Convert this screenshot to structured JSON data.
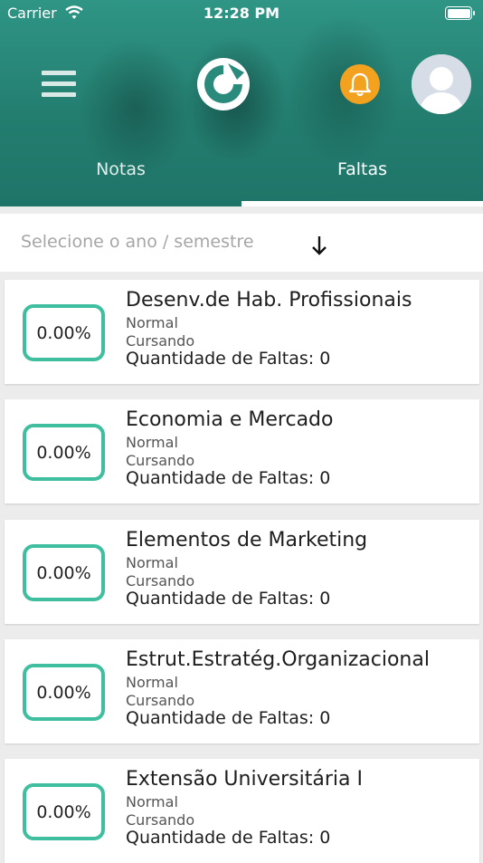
{
  "status_bar": {
    "carrier": "Carrier",
    "time": "12:28 PM"
  },
  "header": {
    "tabs": [
      {
        "label": "Notas",
        "active": false
      },
      {
        "label": "Faltas",
        "active": true
      }
    ]
  },
  "selector": {
    "placeholder": "Selecione o ano / semestre"
  },
  "colors": {
    "header_teal": "#237e70",
    "badge_border": "#3fbf9f",
    "bell": "#f3a21f"
  },
  "courses": [
    {
      "percent": "0.00%",
      "name": "Desenv.de Hab. Profissionais",
      "type": "Normal",
      "status": "Cursando",
      "faltas": "Quantidade de Faltas: 0"
    },
    {
      "percent": "0.00%",
      "name": "Economia e Mercado",
      "type": "Normal",
      "status": "Cursando",
      "faltas": "Quantidade de Faltas: 0"
    },
    {
      "percent": "0.00%",
      "name": "Elementos de Marketing",
      "type": "Normal",
      "status": "Cursando",
      "faltas": "Quantidade de Faltas: 0"
    },
    {
      "percent": "0.00%",
      "name": "Estrut.Estratég.Organizacional",
      "type": "Normal",
      "status": "Cursando",
      "faltas": "Quantidade de Faltas: 0"
    },
    {
      "percent": "0.00%",
      "name": "Extensão Universitária I",
      "type": "Normal",
      "status": "Cursando",
      "faltas": "Quantidade de Faltas: 0"
    }
  ]
}
